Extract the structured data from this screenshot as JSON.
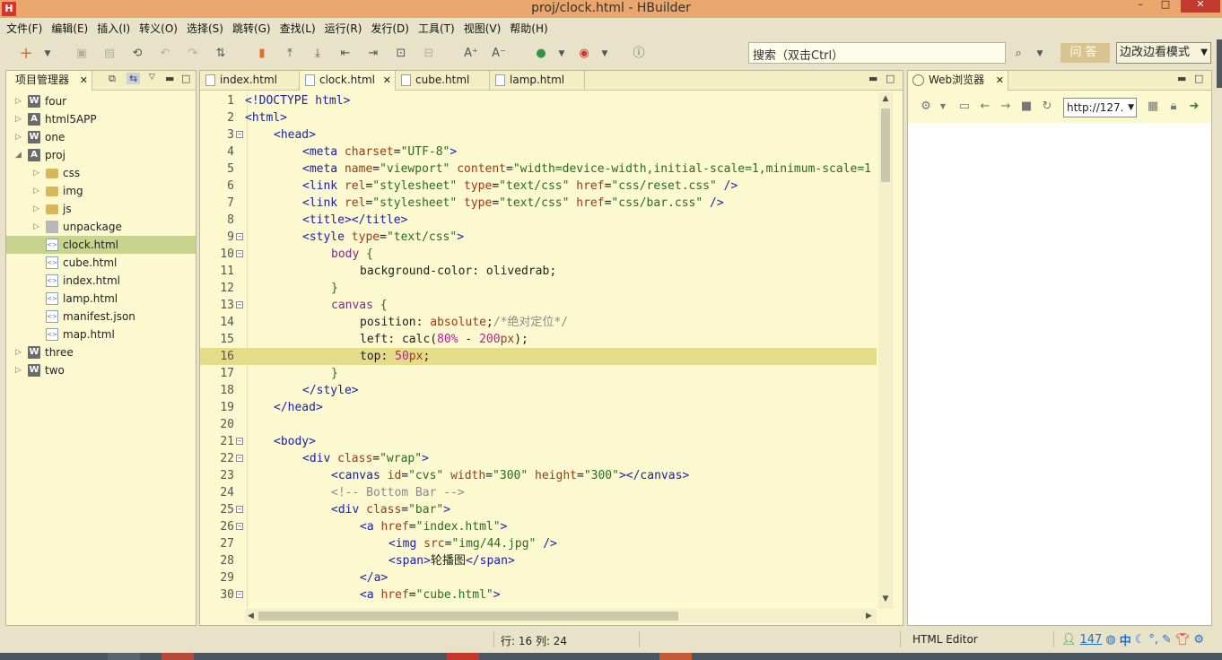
{
  "window": {
    "title": "proj/clock.html  -  HBuilder",
    "logo": "H",
    "min": "–",
    "max": "□",
    "close": "✕"
  },
  "menu": [
    "文件(F)",
    "编辑(E)",
    "插入(I)",
    "转义(O)",
    "选择(S)",
    "跳转(G)",
    "查找(L)",
    "运行(R)",
    "发行(D)",
    "工具(T)",
    "视图(V)",
    "帮助(H)"
  ],
  "toolbar": {
    "search_placeholder": "搜索（双击Ctrl）",
    "qa_label": "问答",
    "mode_label": "边改边看模式",
    "icons": [
      "new-icon",
      "save-icon",
      "save-all-icon",
      "history-icon",
      "undo-icon",
      "redo-icon",
      "format-icon",
      "bookmark-icon",
      "bookmark-prev-icon",
      "bookmark-next-icon",
      "goto-start-icon",
      "goto-end-icon",
      "comment-icon",
      "uncomment-icon",
      "font-increase-icon",
      "font-decrease-icon",
      "run-icon",
      "chrome-icon",
      "info-icon",
      "search-icon"
    ]
  },
  "explorer": {
    "tab_label": "项目管理器",
    "tree": [
      {
        "label": "four",
        "level": 0,
        "icon": "W",
        "type": "project",
        "expanded": false
      },
      {
        "label": "html5APP",
        "level": 0,
        "icon": "A",
        "type": "project",
        "expanded": false
      },
      {
        "label": "one",
        "level": 0,
        "icon": "W",
        "type": "project",
        "expanded": false
      },
      {
        "label": "proj",
        "level": 0,
        "icon": "A",
        "type": "project",
        "expanded": true
      },
      {
        "label": "css",
        "level": 1,
        "type": "folder",
        "expanded": false
      },
      {
        "label": "img",
        "level": 1,
        "type": "folder",
        "expanded": false
      },
      {
        "label": "js",
        "level": 1,
        "type": "folder",
        "expanded": false
      },
      {
        "label": "unpackage",
        "level": 1,
        "type": "package",
        "expanded": false
      },
      {
        "label": "clock.html",
        "level": 1,
        "type": "file",
        "selected": true
      },
      {
        "label": "cube.html",
        "level": 1,
        "type": "file"
      },
      {
        "label": "index.html",
        "level": 1,
        "type": "file"
      },
      {
        "label": "lamp.html",
        "level": 1,
        "type": "file"
      },
      {
        "label": "manifest.json",
        "level": 1,
        "type": "file"
      },
      {
        "label": "map.html",
        "level": 1,
        "type": "file"
      },
      {
        "label": "three",
        "level": 0,
        "icon": "W",
        "type": "project",
        "expanded": false
      },
      {
        "label": "two",
        "level": 0,
        "icon": "W",
        "type": "project",
        "expanded": false
      }
    ]
  },
  "editor": {
    "tabs": [
      {
        "label": "index.html",
        "active": false
      },
      {
        "label": "clock.html",
        "active": true
      },
      {
        "label": "cube.html",
        "active": false
      },
      {
        "label": "lamp.html",
        "active": false
      }
    ],
    "current_line": 16,
    "lines": [
      {
        "n": 1,
        "indent": 0,
        "fold": false,
        "tokens": [
          [
            "t-tag",
            "<!DOCTYPE html>"
          ]
        ]
      },
      {
        "n": 2,
        "indent": 0,
        "fold": false,
        "tokens": [
          [
            "t-tag",
            "<html>"
          ]
        ]
      },
      {
        "n": 3,
        "indent": 1,
        "fold": true,
        "tokens": [
          [
            "t-tag",
            "<head>"
          ]
        ]
      },
      {
        "n": 4,
        "indent": 2,
        "fold": false,
        "tokens": [
          [
            "t-tag",
            "<meta "
          ],
          [
            "t-attr",
            "charset"
          ],
          [
            "",
            "="
          ],
          [
            "t-str",
            "\"UTF-8\""
          ],
          [
            "t-tag",
            ">"
          ]
        ]
      },
      {
        "n": 5,
        "indent": 2,
        "fold": false,
        "tokens": [
          [
            "t-tag",
            "<meta "
          ],
          [
            "t-attr",
            "name"
          ],
          [
            "",
            "="
          ],
          [
            "t-str",
            "\"viewport\""
          ],
          [
            "",
            " "
          ],
          [
            "t-attr",
            "content"
          ],
          [
            "",
            "="
          ],
          [
            "t-str",
            "\"width=device-width,initial-scale=1,minimum-scale=1"
          ]
        ]
      },
      {
        "n": 6,
        "indent": 2,
        "fold": false,
        "tokens": [
          [
            "t-tag",
            "<link "
          ],
          [
            "t-attr",
            "rel"
          ],
          [
            "",
            "="
          ],
          [
            "t-str",
            "\"stylesheet\""
          ],
          [
            "",
            " "
          ],
          [
            "t-attr",
            "type"
          ],
          [
            "",
            "="
          ],
          [
            "t-str",
            "\"text/css\""
          ],
          [
            "",
            " "
          ],
          [
            "t-attr",
            "href"
          ],
          [
            "",
            "="
          ],
          [
            "t-str",
            "\"css/reset.css\""
          ],
          [
            "t-tag",
            " />"
          ]
        ]
      },
      {
        "n": 7,
        "indent": 2,
        "fold": false,
        "tokens": [
          [
            "t-tag",
            "<link "
          ],
          [
            "t-attr",
            "rel"
          ],
          [
            "",
            "="
          ],
          [
            "t-str",
            "\"stylesheet\""
          ],
          [
            "",
            " "
          ],
          [
            "t-attr",
            "type"
          ],
          [
            "",
            "="
          ],
          [
            "t-str",
            "\"text/css\""
          ],
          [
            "",
            " "
          ],
          [
            "t-attr",
            "href"
          ],
          [
            "",
            "="
          ],
          [
            "t-str",
            "\"css/bar.css\""
          ],
          [
            "t-tag",
            " />"
          ]
        ]
      },
      {
        "n": 8,
        "indent": 2,
        "fold": false,
        "tokens": [
          [
            "t-tag",
            "<title></title>"
          ]
        ]
      },
      {
        "n": 9,
        "indent": 2,
        "fold": true,
        "tokens": [
          [
            "t-tag",
            "<style "
          ],
          [
            "t-attr",
            "type"
          ],
          [
            "",
            "="
          ],
          [
            "t-str",
            "\"text/css\""
          ],
          [
            "t-tag",
            ">"
          ]
        ]
      },
      {
        "n": 10,
        "indent": 3,
        "fold": true,
        "tokens": [
          [
            "t-sel",
            "body"
          ],
          [
            "t-str",
            " {"
          ]
        ]
      },
      {
        "n": 11,
        "indent": 4,
        "fold": false,
        "tokens": [
          [
            "t-prop",
            "background-color"
          ],
          [
            "",
            ": "
          ],
          [
            "t-prop",
            "olivedrab"
          ],
          [
            "",
            ";"
          ]
        ]
      },
      {
        "n": 12,
        "indent": 3,
        "fold": false,
        "tokens": [
          [
            "t-str",
            "}"
          ]
        ]
      },
      {
        "n": 13,
        "indent": 3,
        "fold": true,
        "tokens": [
          [
            "t-sel",
            "canvas"
          ],
          [
            "t-str",
            " {"
          ]
        ]
      },
      {
        "n": 14,
        "indent": 4,
        "fold": false,
        "tokens": [
          [
            "t-prop",
            "position"
          ],
          [
            "",
            ": "
          ],
          [
            "t-attr",
            "absolute"
          ],
          [
            "",
            ";"
          ],
          [
            "t-com",
            "/*绝对定位*/"
          ]
        ]
      },
      {
        "n": 15,
        "indent": 4,
        "fold": false,
        "tokens": [
          [
            "t-prop",
            "left"
          ],
          [
            "",
            ": calc("
          ],
          [
            "t-num",
            "80%"
          ],
          [
            "",
            " - "
          ],
          [
            "t-num",
            "200"
          ],
          [
            "t-attr",
            "px"
          ],
          [
            "",
            ");"
          ]
        ]
      },
      {
        "n": 16,
        "indent": 4,
        "fold": false,
        "tokens": [
          [
            "t-prop",
            "top"
          ],
          [
            "",
            ": "
          ],
          [
            "t-num",
            "50"
          ],
          [
            "t-attr",
            "px"
          ],
          [
            "",
            ";"
          ]
        ]
      },
      {
        "n": 17,
        "indent": 3,
        "fold": false,
        "tokens": [
          [
            "t-str",
            "}"
          ]
        ]
      },
      {
        "n": 18,
        "indent": 2,
        "fold": false,
        "tokens": [
          [
            "t-tag",
            "</style>"
          ]
        ]
      },
      {
        "n": 19,
        "indent": 1,
        "fold": false,
        "tokens": [
          [
            "t-tag",
            "</head>"
          ]
        ]
      },
      {
        "n": 20,
        "indent": 0,
        "fold": false,
        "tokens": []
      },
      {
        "n": 21,
        "indent": 1,
        "fold": true,
        "tokens": [
          [
            "t-tag",
            "<body>"
          ]
        ]
      },
      {
        "n": 22,
        "indent": 2,
        "fold": true,
        "tokens": [
          [
            "t-tag",
            "<div "
          ],
          [
            "t-attr",
            "class"
          ],
          [
            "",
            "="
          ],
          [
            "t-str",
            "\"wrap\""
          ],
          [
            "t-tag",
            ">"
          ]
        ]
      },
      {
        "n": 23,
        "indent": 3,
        "fold": false,
        "tokens": [
          [
            "t-tag",
            "<canvas "
          ],
          [
            "t-attr",
            "id"
          ],
          [
            "",
            "="
          ],
          [
            "t-str",
            "\"cvs\""
          ],
          [
            "",
            " "
          ],
          [
            "t-attr",
            "width"
          ],
          [
            "",
            "="
          ],
          [
            "t-str",
            "\"300\""
          ],
          [
            "",
            " "
          ],
          [
            "t-attr",
            "height"
          ],
          [
            "",
            "="
          ],
          [
            "t-str",
            "\"300\""
          ],
          [
            "t-tag",
            "></canvas>"
          ]
        ]
      },
      {
        "n": 24,
        "indent": 3,
        "fold": false,
        "tokens": [
          [
            "t-com",
            "<!-- Bottom Bar -->"
          ]
        ]
      },
      {
        "n": 25,
        "indent": 3,
        "fold": true,
        "tokens": [
          [
            "t-tag",
            "<div "
          ],
          [
            "t-attr",
            "class"
          ],
          [
            "",
            "="
          ],
          [
            "t-str",
            "\"bar\""
          ],
          [
            "t-tag",
            ">"
          ]
        ]
      },
      {
        "n": 26,
        "indent": 4,
        "fold": true,
        "tokens": [
          [
            "t-tag",
            "<a "
          ],
          [
            "t-attr",
            "href"
          ],
          [
            "",
            "="
          ],
          [
            "t-str",
            "\"index.html\""
          ],
          [
            "t-tag",
            ">"
          ]
        ]
      },
      {
        "n": 27,
        "indent": 5,
        "fold": false,
        "tokens": [
          [
            "t-tag",
            "<img "
          ],
          [
            "t-attr",
            "src"
          ],
          [
            "",
            "="
          ],
          [
            "t-str",
            "\"img/44.jpg\""
          ],
          [
            "t-tag",
            " />"
          ]
        ]
      },
      {
        "n": 28,
        "indent": 5,
        "fold": false,
        "tokens": [
          [
            "t-tag",
            "<span>"
          ],
          [
            "",
            "轮播图"
          ],
          [
            "t-tag",
            "</span>"
          ]
        ]
      },
      {
        "n": 29,
        "indent": 4,
        "fold": false,
        "tokens": [
          [
            "t-tag",
            "</a>"
          ]
        ]
      },
      {
        "n": 30,
        "indent": 4,
        "fold": true,
        "tokens": [
          [
            "t-tag",
            "<a "
          ],
          [
            "t-attr",
            "href"
          ],
          [
            "",
            "="
          ],
          [
            "t-str",
            "\"cube.html\""
          ],
          [
            "t-tag",
            ">"
          ]
        ]
      }
    ]
  },
  "browser": {
    "tab_label": "Web浏览器",
    "url": "http://127.",
    "icons": [
      "settings-icon",
      "console-icon",
      "back-icon",
      "forward-icon",
      "stop-icon",
      "refresh-icon",
      "qr-icon",
      "lock-icon",
      "go-icon"
    ]
  },
  "status": {
    "position": "行: 16 列: 24",
    "mode": "HTML Editor",
    "tray_count": "147",
    "ime": "中"
  }
}
